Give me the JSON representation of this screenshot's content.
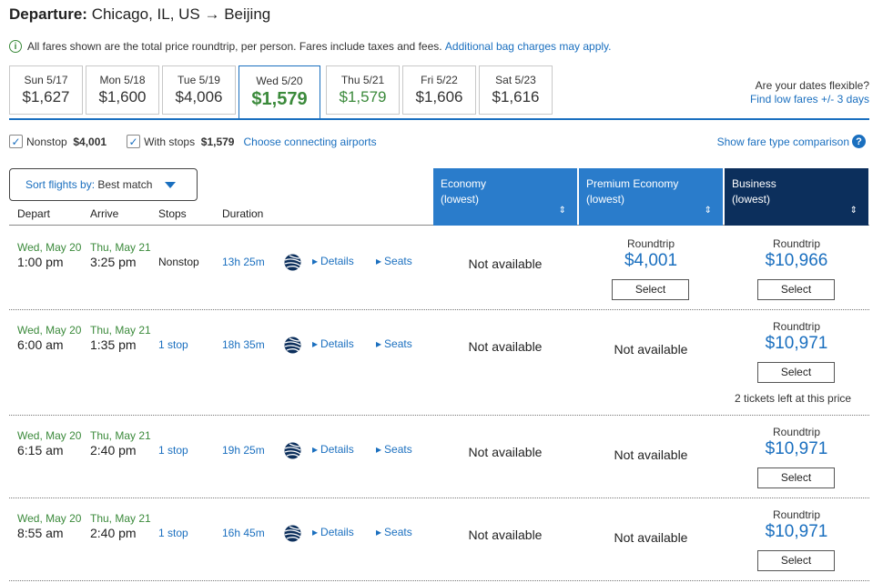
{
  "header": {
    "label": "Departure:",
    "route": "Chicago, IL, US → Beijing"
  },
  "info": {
    "text": "All fares shown are the total price roundtrip, per person. Fares include taxes and fees.",
    "link": "Additional bag charges may apply."
  },
  "dates": [
    {
      "day": "Sun 5/17",
      "price": "$1,627"
    },
    {
      "day": "Mon 5/18",
      "price": "$1,600"
    },
    {
      "day": "Tue 5/19",
      "price": "$4,006"
    },
    {
      "day": "Wed 5/20",
      "price": "$1,579",
      "selected": true
    },
    {
      "day": "Thu 5/21",
      "price": "$1,579",
      "green": true
    },
    {
      "day": "Fri 5/22",
      "price": "$1,606"
    },
    {
      "day": "Sat 5/23",
      "price": "$1,616"
    }
  ],
  "flex": {
    "question": "Are your dates flexible?",
    "link": "Find low fares +/- 3 days"
  },
  "filters": {
    "nonstop_label": "Nonstop",
    "nonstop_price": "$4,001",
    "withstops_label": "With stops",
    "withstops_price": "$1,579",
    "connecting_link": "Choose connecting airports",
    "fare_compare": "Show fare type comparison"
  },
  "sort": {
    "label": "Sort flights by:",
    "value": "Best match"
  },
  "columns": {
    "depart": "Depart",
    "arrive": "Arrive",
    "stops": "Stops",
    "duration": "Duration"
  },
  "cabins": [
    {
      "name": "Economy",
      "sub": "(lowest)",
      "color": "#2a7ccb"
    },
    {
      "name": "Premium Economy",
      "sub": "(lowest)",
      "color": "#2a7ccb"
    },
    {
      "name": "Business",
      "sub": "(lowest)",
      "color": "#0c2f5c"
    }
  ],
  "labels": {
    "details": "Details",
    "seats": "Seats",
    "roundtrip": "Roundtrip",
    "select": "Select",
    "not_available": "Not available"
  },
  "flights": [
    {
      "dep_date": "Wed, May 20",
      "dep_time": "1:00 pm",
      "arr_date": "Thu, May 21",
      "arr_time": "3:25 pm",
      "stops": "Nonstop",
      "duration": "13h 25m",
      "premium_price": "$4,001",
      "business_price": "$10,966",
      "note": ""
    },
    {
      "dep_date": "Wed, May 20",
      "dep_time": "6:00 am",
      "arr_date": "Thu, May 21",
      "arr_time": "1:35 pm",
      "stops": "1 stop",
      "duration": "18h 35m",
      "premium_price": "",
      "business_price": "$10,971",
      "note": "2 tickets left at this price"
    },
    {
      "dep_date": "Wed, May 20",
      "dep_time": "6:15 am",
      "arr_date": "Thu, May 21",
      "arr_time": "2:40 pm",
      "stops": "1 stop",
      "duration": "19h 25m",
      "premium_price": "",
      "business_price": "$10,971",
      "note": ""
    },
    {
      "dep_date": "Wed, May 20",
      "dep_time": "8:55 am",
      "arr_date": "Thu, May 21",
      "arr_time": "2:40 pm",
      "stops": "1 stop",
      "duration": "16h 45m",
      "premium_price": "",
      "business_price": "$10,971",
      "note": ""
    }
  ]
}
